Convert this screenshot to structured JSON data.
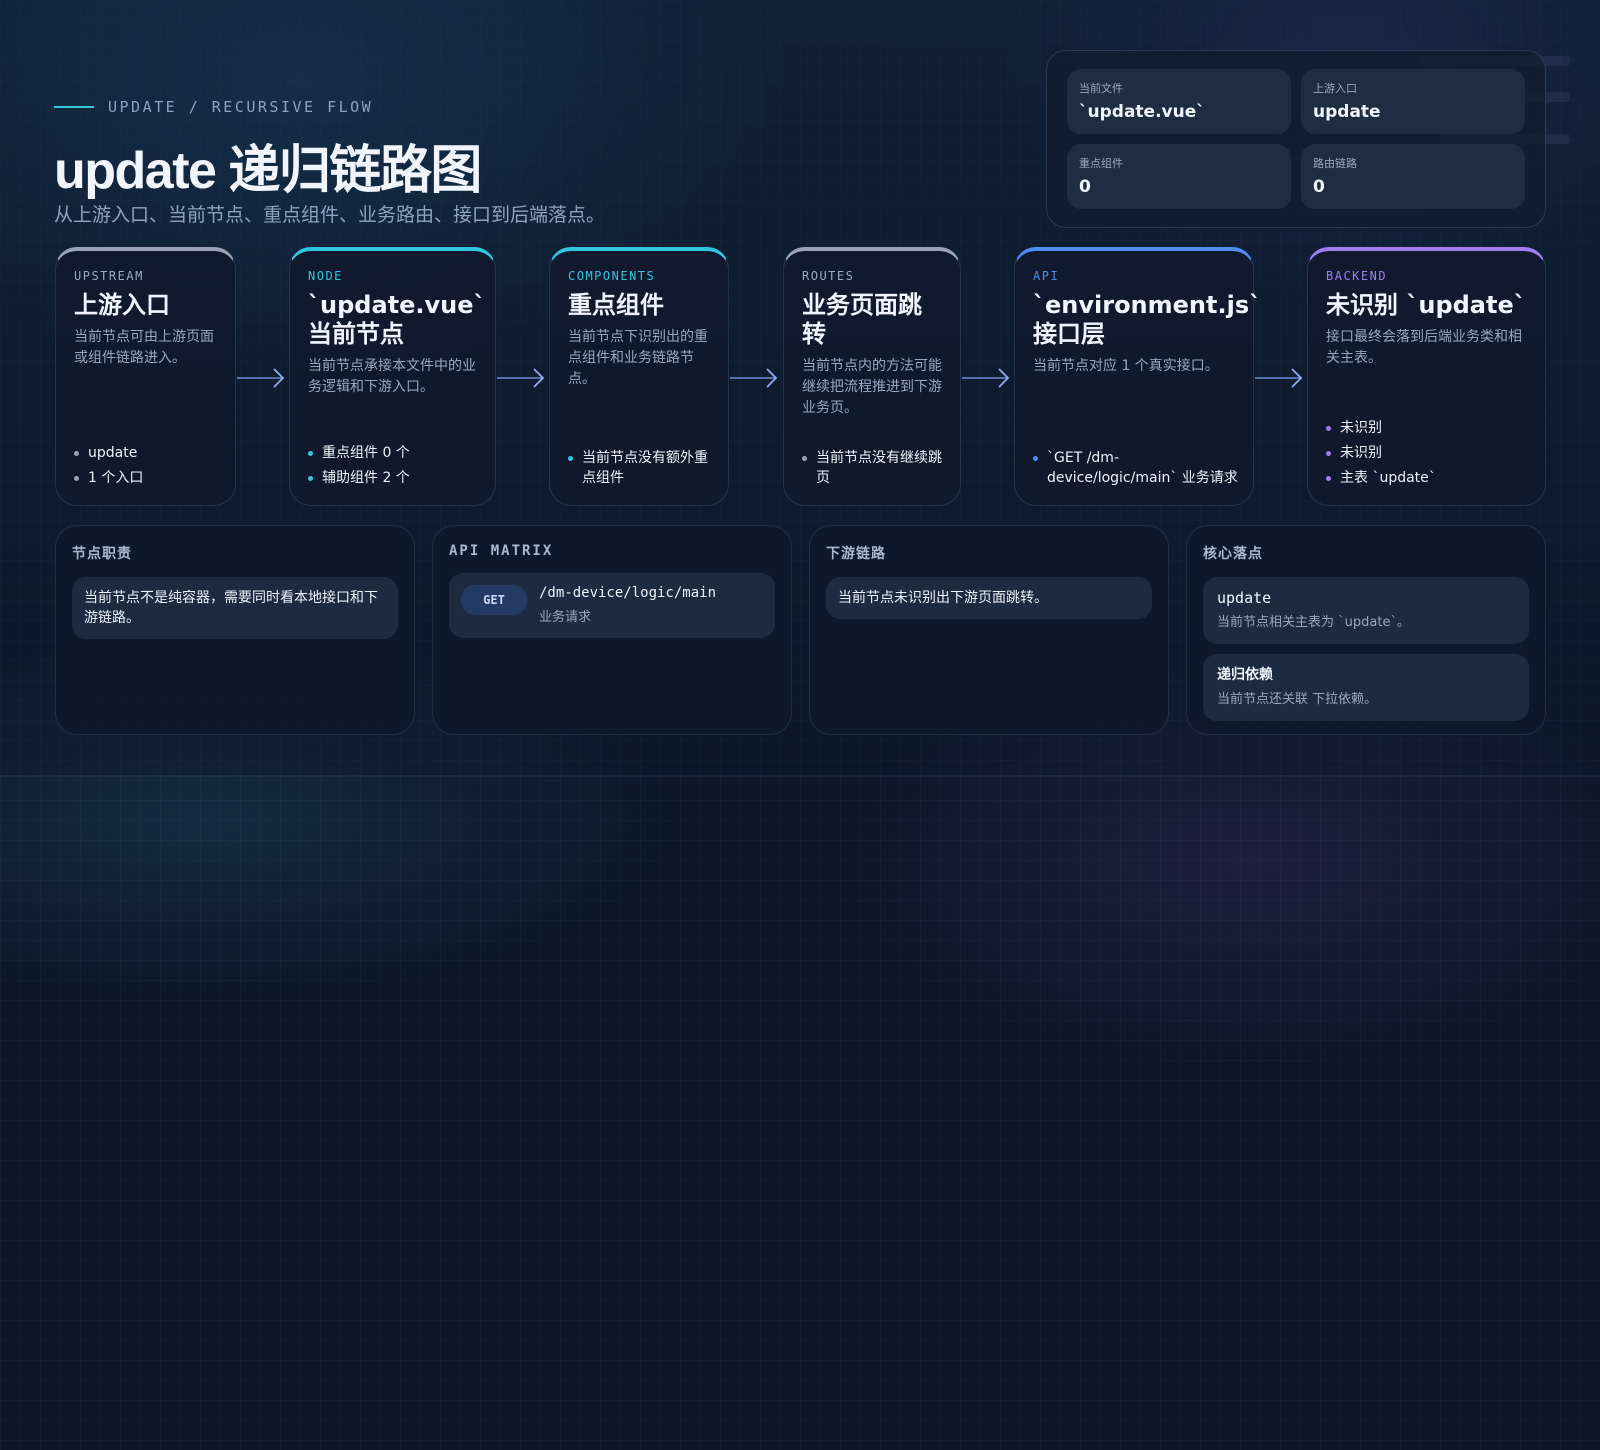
{
  "header": {
    "eyebrow": "UPDATE / RECURSIVE FLOW",
    "title": "update 递归链路图",
    "subtitle": "从上游入口、当前节点、重点组件、业务路由、接口到后端落点。"
  },
  "stats": [
    {
      "label": "当前文件",
      "value": "`update.vue`"
    },
    {
      "label": "上游入口",
      "value": "update"
    },
    {
      "label": "重点组件",
      "value": "0"
    },
    {
      "label": "路由链路",
      "value": "0"
    }
  ],
  "flow": [
    {
      "tag": "UPSTREAM",
      "title": "上游入口",
      "desc": "当前节点可由上游页面或组件链路进入。",
      "items": [
        "update",
        "1 个入口"
      ],
      "accent": "#9aa3b5"
    },
    {
      "tag": "NODE",
      "title": "`update.vue` 当前节点",
      "desc": "当前节点承接本文件中的业务逻辑和下游入口。",
      "items": [
        "重点组件 0 个",
        "辅助组件 2 个"
      ],
      "accent": "#2fc7e0"
    },
    {
      "tag": "COMPONENTS",
      "title": "重点组件",
      "desc": "当前节点下识别出的重点组件和业务链路节点。",
      "items": [
        "当前节点没有额外重点组件"
      ],
      "accent": "#2fc7e0"
    },
    {
      "tag": "ROUTES",
      "title": "业务页面跳转",
      "desc": "当前节点内的方法可能继续把流程推进到下游业务页。",
      "items": [
        "当前节点没有继续跳页"
      ],
      "accent": "#9aa3b5"
    },
    {
      "tag": "API",
      "title": "`environment.js` 接口层",
      "desc": "当前节点对应 1 个真实接口。",
      "items": [
        "`GET /dm-device/logic/main` 业务请求"
      ],
      "accent": "#4b8df0"
    },
    {
      "tag": "BACKEND",
      "title": "未识别 `update`",
      "desc": "接口最终会落到后端业务类和相关主表。",
      "items": [
        "未识别",
        "未识别",
        "主表 `update`"
      ],
      "accent": "#a07ef0"
    }
  ],
  "panels": {
    "duty": {
      "title": "节点职责",
      "text": "当前节点不是纯容器，需要同时看本地接口和下游链路。"
    },
    "api": {
      "title": "API MATRIX",
      "method": "GET",
      "path": "/dm-device/logic/main",
      "desc": "业务请求"
    },
    "downstream": {
      "title": "下游链路",
      "text": "当前节点未识别出下游页面跳转。"
    },
    "core": {
      "title": "核心落点",
      "items": [
        {
          "name": "update",
          "desc": "当前节点相关主表为 `update`。"
        },
        {
          "name": "递归依赖",
          "desc": "当前节点还关联 下拉依赖。"
        }
      ]
    }
  }
}
